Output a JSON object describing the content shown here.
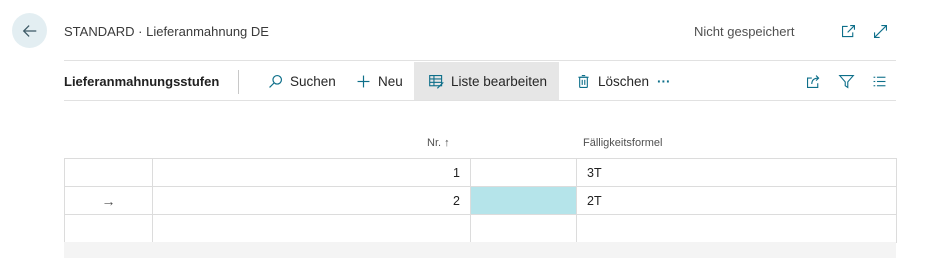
{
  "header": {
    "title": "STANDARD · Lieferanmahnung DE",
    "save_status": "Nicht gespeichert",
    "icons": [
      "back-arrow-icon",
      "open-in-new-window-icon",
      "expand-icon"
    ]
  },
  "toolbar": {
    "caption": "Lieferanmahnungsstufen",
    "search_label": "Suchen",
    "new_label": "Neu",
    "edit_list_label": "Liste bearbeiten",
    "delete_label": "Löschen",
    "more_label": "···",
    "icons": [
      "share-icon",
      "filter-icon",
      "list-view-icon"
    ]
  },
  "table": {
    "columns": [
      {
        "label": "Nr. ↑"
      },
      {
        "label": ""
      },
      {
        "label": "Fälligkeitsformel"
      }
    ],
    "rows": [
      {
        "indicator": "",
        "nr": "1",
        "extra": "",
        "formula": "3T",
        "selected": false
      },
      {
        "indicator": "→",
        "nr": "2",
        "extra": "",
        "formula": "2T",
        "selected": true
      },
      {
        "indicator": "",
        "nr": "",
        "extra": "",
        "formula": "",
        "selected": false
      }
    ]
  },
  "colors": {
    "accent": "#0e6f8a",
    "selected_cell": "#b5e4ea",
    "back_button_bg": "#e3eef2",
    "active_action_bg": "#e6e6e6"
  }
}
